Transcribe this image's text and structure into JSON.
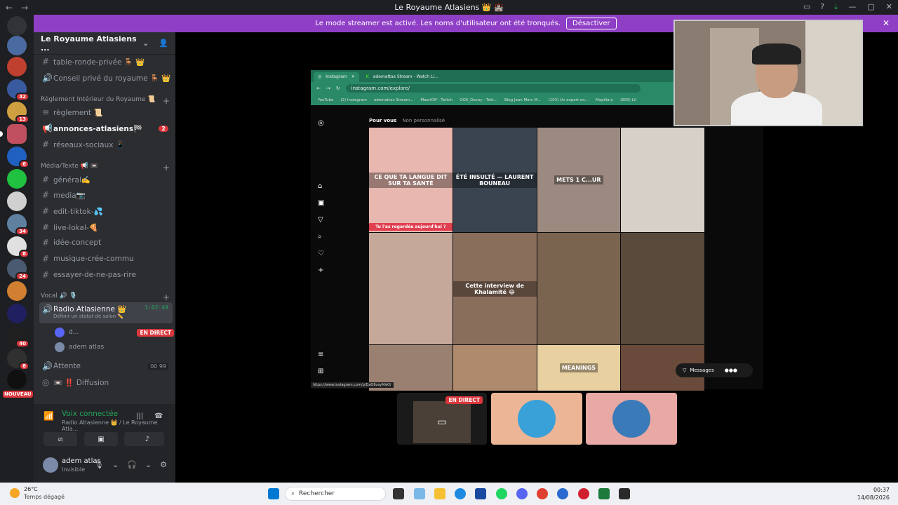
{
  "window": {
    "title": "Le Royaume Atlasiens 👑 🏰",
    "back_icon": "←",
    "forward_icon": "→"
  },
  "streamer_banner": {
    "text": "Le mode streamer est activé. Les noms d'utilisateur ont été tronqués.",
    "button": "Désactiver",
    "close": "✕"
  },
  "server": {
    "name": "Le Royaume Atlasiens ...",
    "channels": [
      {
        "type": "text",
        "label": "table-ronde-privée 🪑 👑"
      },
      {
        "type": "text",
        "label": "Conseil privé du royaume 🪑 👑"
      }
    ],
    "categories": [
      {
        "label": "Règlement Intérieur du Royaume 📜",
        "channels": [
          {
            "label": "règlement 📜"
          },
          {
            "label": "annonces-atlasiens🏁",
            "badge": "2"
          },
          {
            "label": "réseaux-sociaux 📱"
          }
        ]
      },
      {
        "label": "Média/Texte 📢 📼",
        "channels": [
          {
            "label": "général✍️"
          },
          {
            "label": "media📷"
          },
          {
            "label": "edit-tiktok-💦"
          },
          {
            "label": "live-lokal-🍕"
          },
          {
            "label": "idée-concept"
          },
          {
            "label": "musique-crée-commu"
          },
          {
            "label": "essayer-de-ne-pas-rire"
          }
        ]
      },
      {
        "label": "Vocal 🔊 🎙️",
        "voice_channel": {
          "label": "Radio Atlasienne 👑",
          "timer": "1:02:49",
          "status": "Définir un statut de salon ✏️",
          "users": [
            {
              "name": "d...",
              "badge": "EN DIRECT"
            },
            {
              "name": "adem atlas"
            }
          ]
        },
        "extra": [
          {
            "label": "Attente",
            "counter": "00 99"
          },
          {
            "label": "📼 ‼️ Diffusion"
          }
        ]
      }
    ]
  },
  "guild_badges": [
    "32",
    "13",
    "6",
    "34",
    "8",
    "24",
    "40",
    "8"
  ],
  "guild_new_label": "NOUVEAU",
  "voice_panel": {
    "status": "Voix connectée",
    "channel": "Radio Atlasienne 👑 / Le Royaume Atla..."
  },
  "user_panel": {
    "name": "adem atlas",
    "status": "Invisible"
  },
  "browser": {
    "tabs": [
      "Instagram",
      "ademattas Stream - Watch Li..."
    ],
    "url": "instagram.com/explore/",
    "bookmarks": [
      "YouTube",
      "(2) Instagram",
      "ademattas Stream...",
      "MaeriOff - Twitch",
      "OGK_Decoy - Twit...",
      "Blog Jean Marc M...",
      "(103) Un expert en...",
      "Mapillary",
      "(650) Lil"
    ],
    "ig_tab_on": "Pour vous",
    "ig_tab_off": "Non personnalisé",
    "tiles": [
      {
        "caption": "CE QUE TA LANGUE DIT SUR TA SANTÉ",
        "bg": "#e8b8b0"
      },
      {
        "caption": "ÉTÉ INSULTÉ — LAURENT BOUNEAU",
        "bg": "#3a4450"
      },
      {
        "caption": "METS 1 C...UR",
        "bg": "#9c8a80"
      },
      {
        "caption": "",
        "bg": "#d6d0c8"
      },
      {
        "caption": "",
        "bg": "#c6a89a"
      },
      {
        "caption": "Cette interview de Khalamité 😂",
        "bg": "#8a6e5c"
      },
      {
        "caption": "",
        "bg": "#7a6450"
      },
      {
        "caption": "",
        "bg": "#5a4a3c"
      },
      {
        "caption": "",
        "bg": "#9a8070"
      },
      {
        "caption": "",
        "bg": "#b08a6c"
      },
      {
        "caption": "MEANINGS",
        "bg": "#e8d0a0"
      },
      {
        "caption": "",
        "bg": "#6a4a3a"
      }
    ],
    "tile_extra_caption": "Tu l'as regardée aujourd'hui ?",
    "messages": "Messages",
    "status_url": "https://www.instagram.com/p/DaO8osyMsKI/"
  },
  "live_badge": "EN DIRECT",
  "taskbar": {
    "temp": "26°C",
    "weather": "Temps dégagé",
    "search": "Rechercher",
    "time": "00:37",
    "date": "14/08/2026"
  }
}
